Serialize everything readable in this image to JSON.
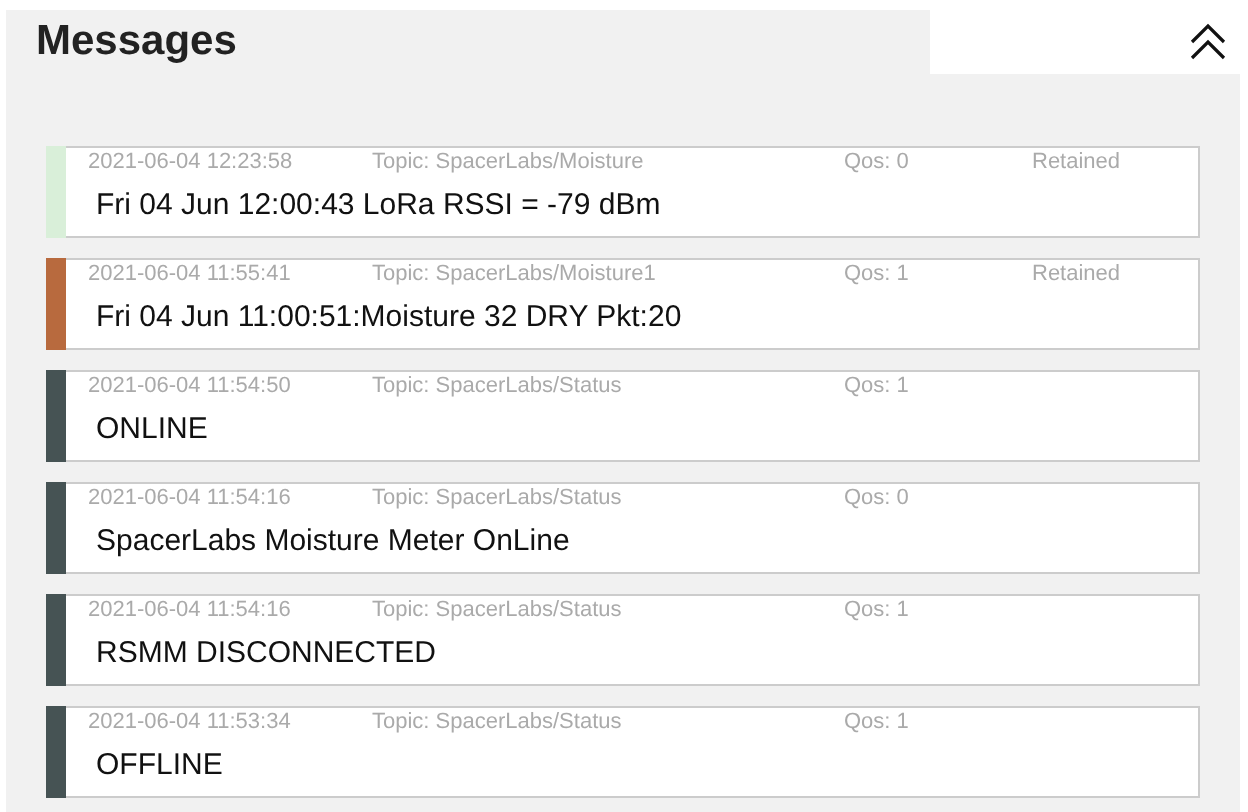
{
  "title": "Messages",
  "messages": [
    {
      "time": "2021-06-04 12:23:58",
      "topic": "Topic: SpacerLabs/Moisture",
      "qos": "Qos: 0",
      "retained": "Retained",
      "payload": "Fri 04 Jun 12:00:43 LoRa RSSI = -79 dBm",
      "color": "#d9efd9"
    },
    {
      "time": "2021-06-04 11:55:41",
      "topic": "Topic: SpacerLabs/Moisture1",
      "qos": "Qos: 1",
      "retained": "Retained",
      "payload": "Fri 04 Jun 11:00:51:Moisture 32 DRY Pkt:20",
      "color": "#b86a3e"
    },
    {
      "time": "2021-06-04 11:54:50",
      "topic": "Topic: SpacerLabs/Status",
      "qos": "Qos: 1",
      "payload": "ONLINE",
      "color": "#465354"
    },
    {
      "time": "2021-06-04 11:54:16",
      "topic": "Topic: SpacerLabs/Status",
      "qos": "Qos: 0",
      "payload": "SpacerLabs Moisture Meter OnLine",
      "color": "#465354"
    },
    {
      "time": "2021-06-04 11:54:16",
      "topic": "Topic: SpacerLabs/Status",
      "qos": "Qos: 1",
      "payload": "RSMM DISCONNECTED",
      "color": "#465354"
    },
    {
      "time": "2021-06-04 11:53:34",
      "topic": "Topic: SpacerLabs/Status",
      "qos": "Qos: 1",
      "payload": "OFFLINE",
      "color": "#465354"
    }
  ]
}
